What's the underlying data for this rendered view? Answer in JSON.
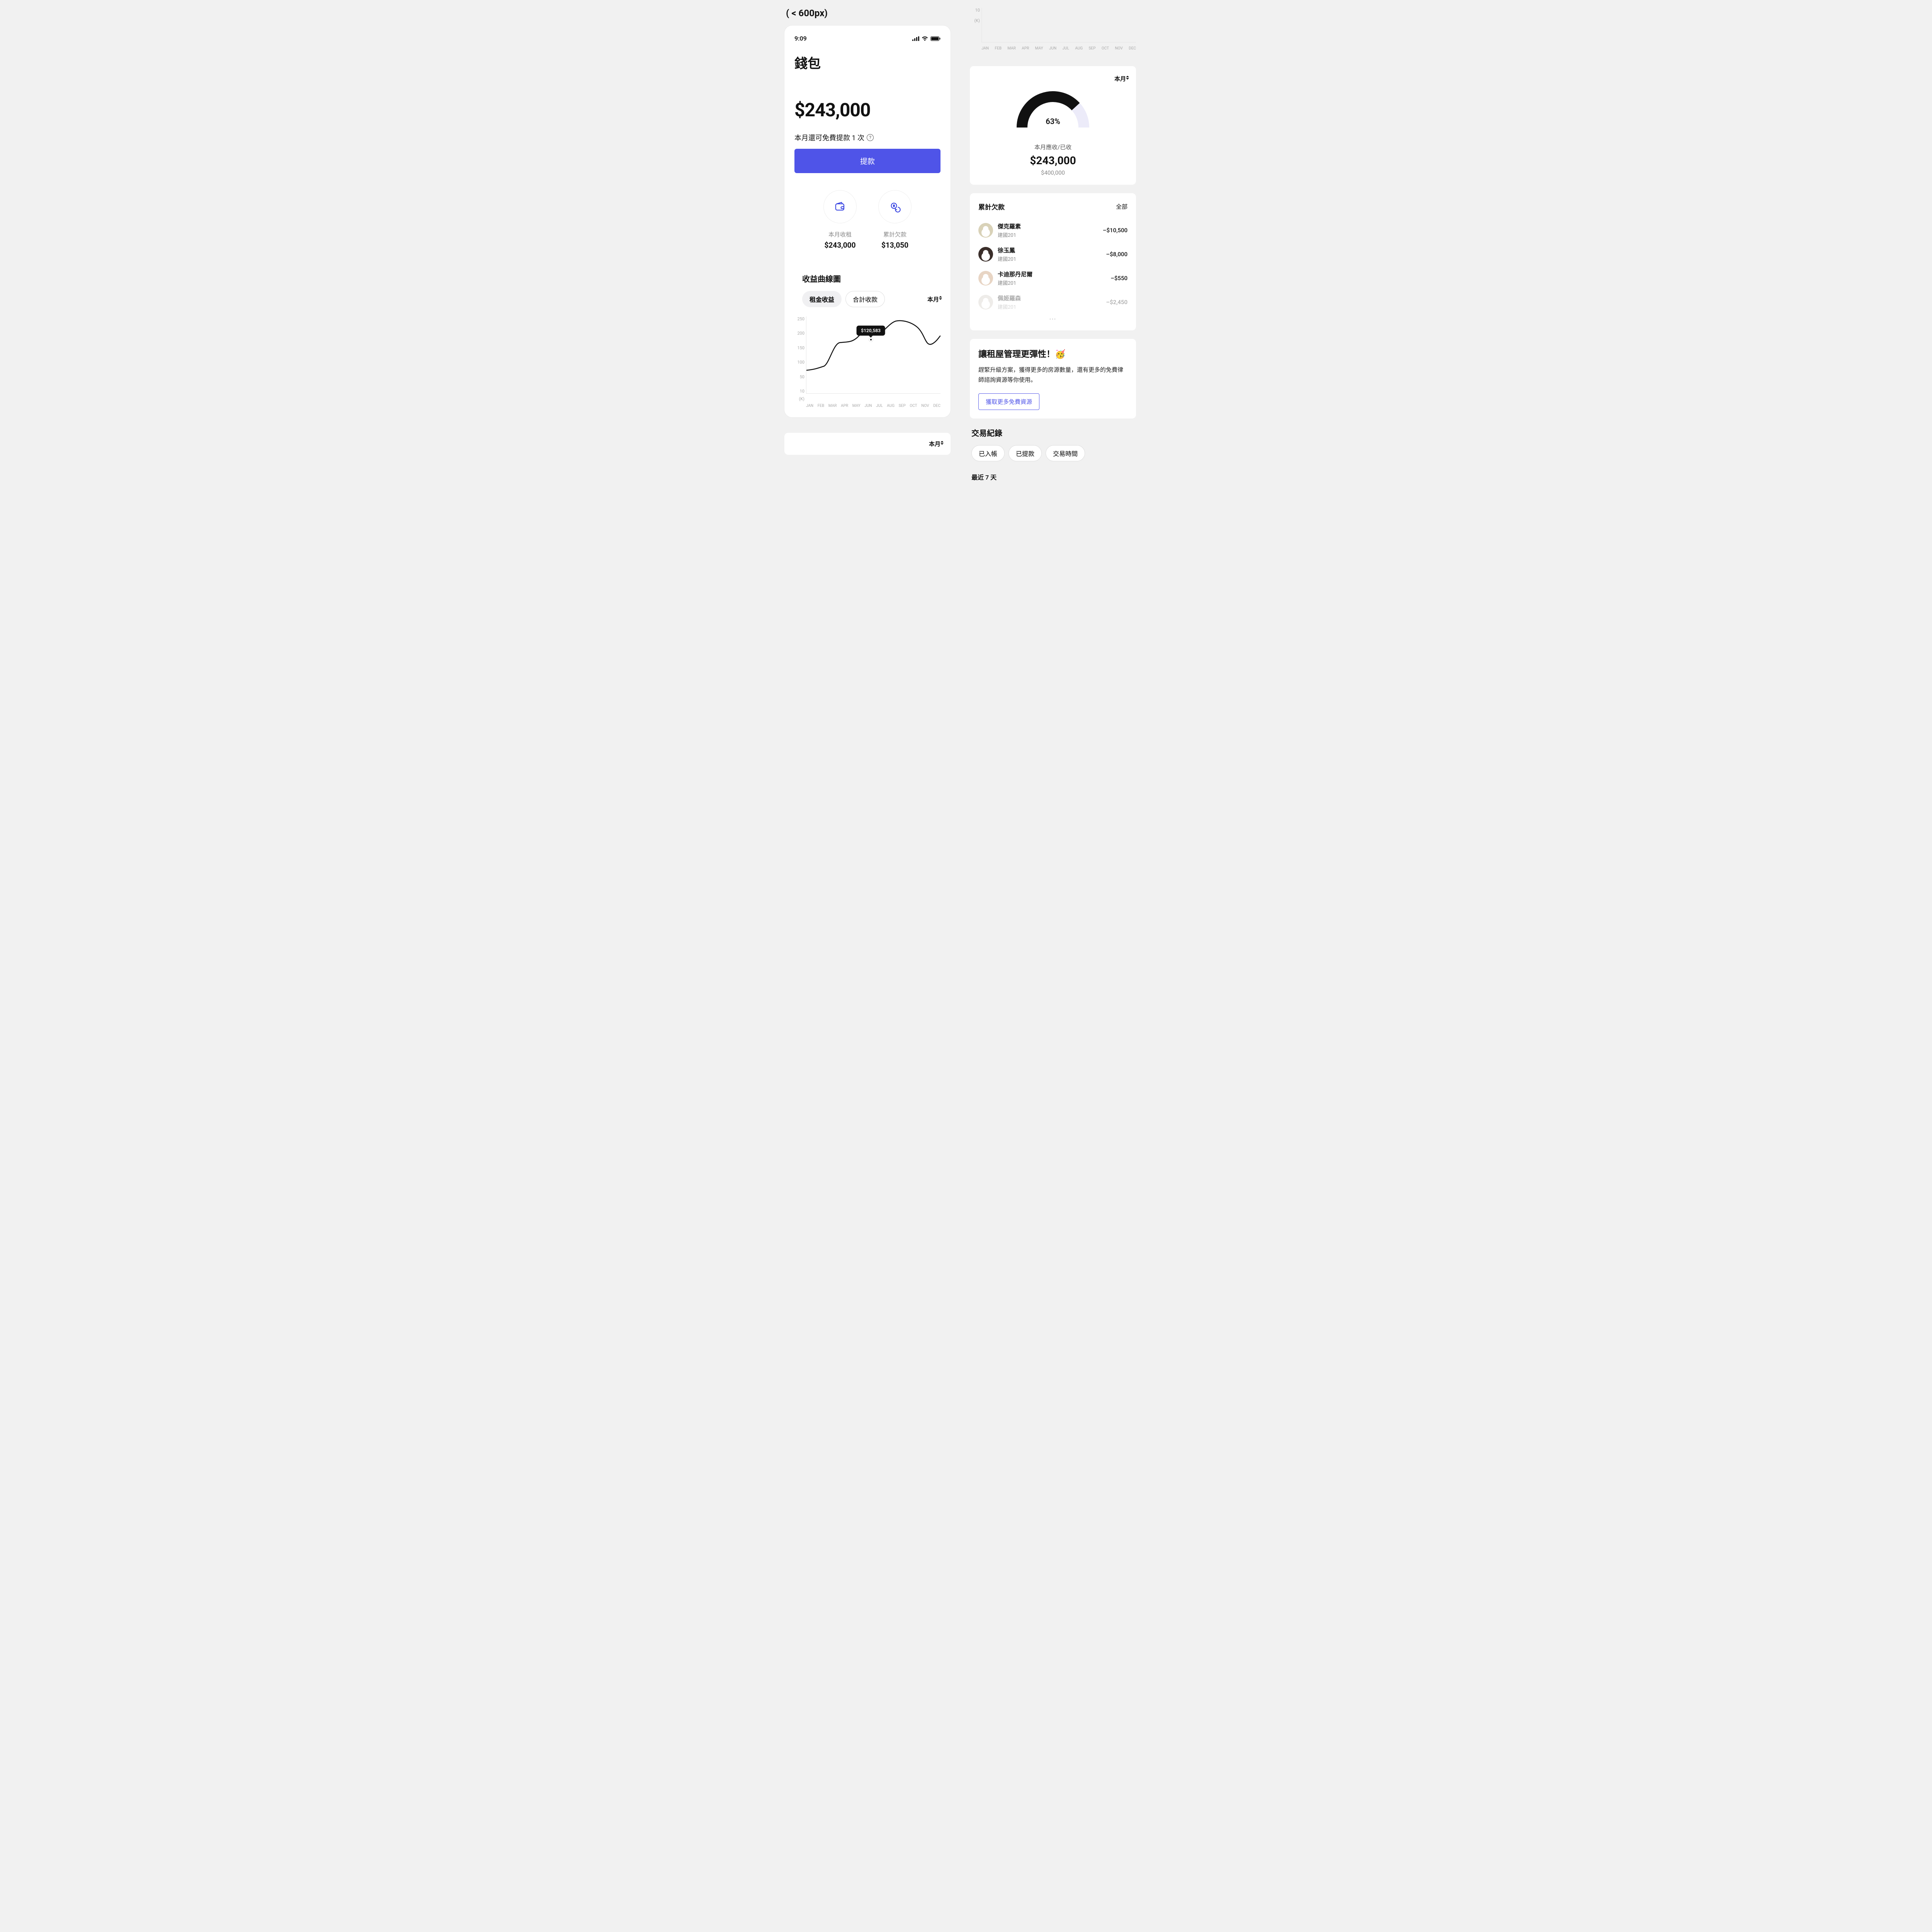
{
  "breakpoint_label": "( < 600px)",
  "status": {
    "time": "9:09"
  },
  "wallet": {
    "title": "錢包",
    "balance": "$243,000",
    "withdraw_info": "本月還可免費提款 1 次",
    "withdraw_button": "提款"
  },
  "stats": {
    "rent": {
      "label": "本月收租",
      "value": "$243,000"
    },
    "arrears": {
      "label": "累計欠款",
      "value": "$13,050"
    }
  },
  "chart": {
    "title": "收益曲線圖",
    "tabs": {
      "rent": "租金收益",
      "total": "合計收款"
    },
    "period_label": "本月",
    "y_ticks": [
      "250",
      "200",
      "150",
      "100",
      "50",
      "10"
    ],
    "y_unit": "(K)",
    "x_labels": [
      "JAN",
      "FEB",
      "MAR",
      "APR",
      "MAY",
      "JUN",
      "JUL",
      "AUG",
      "SEP",
      "OCT",
      "NOV",
      "DEC"
    ],
    "tooltip_value": "$120,583"
  },
  "chart_data": {
    "type": "line",
    "title": "收益曲線圖",
    "xlabel": "",
    "ylabel": "",
    "y_unit": "K",
    "ylim": [
      10,
      250
    ],
    "categories": [
      "JAN",
      "FEB",
      "MAR",
      "APR",
      "MAY",
      "JUN",
      "JUL",
      "AUG",
      "SEP",
      "OCT",
      "NOV",
      "DEC"
    ],
    "series": [
      {
        "name": "租金收益",
        "values": [
          80,
          85,
          150,
          150,
          180,
          200,
          180,
          200,
          210,
          200,
          155,
          170
        ]
      }
    ],
    "highlighted_point": {
      "x": "JUN",
      "label": "$120,583"
    }
  },
  "partial_chart": {
    "y_ticks": [
      "10"
    ],
    "y_unit": "(K)",
    "x_labels": [
      "JAN",
      "FEB",
      "MAR",
      "APR",
      "MAY",
      "JUN",
      "JUL",
      "AUG",
      "SEP",
      "OCT",
      "NOV",
      "DEC"
    ]
  },
  "gauge": {
    "period_label": "本月",
    "percent": "63%",
    "label": "本月應收/已收",
    "value": "$243,000",
    "total": "$400,000"
  },
  "arrears": {
    "title": "累計欠款",
    "all": "全部",
    "items": [
      {
        "name": "傑克羅素",
        "sub": "建國201",
        "amount": "–$10,500",
        "avatar_bg": "#d9d2b8"
      },
      {
        "name": "徐玉鳳",
        "sub": "建國201",
        "amount": "–$8,000",
        "avatar_bg": "#3a2e2a"
      },
      {
        "name": "卡迪那丹尼爾",
        "sub": "建國201",
        "amount": "–$550",
        "avatar_bg": "#e8d5c4"
      },
      {
        "name": "佩姬羅森",
        "sub": "建國201",
        "amount": "–$2,450",
        "avatar_bg": "#cfc9c2"
      }
    ]
  },
  "promo": {
    "title": "讓租屋管理更彈性！🥳",
    "body": "趕緊升級方案，獲得更多的房源數量，還有更多的免費律師諮詢資源等你使用。",
    "cta": "獲取更多免費資源"
  },
  "transactions": {
    "title": "交易紀錄",
    "filters": {
      "posted": "已入帳",
      "withdrawn": "已提款",
      "time": "交易時間"
    },
    "recent": "最近 7 天"
  }
}
